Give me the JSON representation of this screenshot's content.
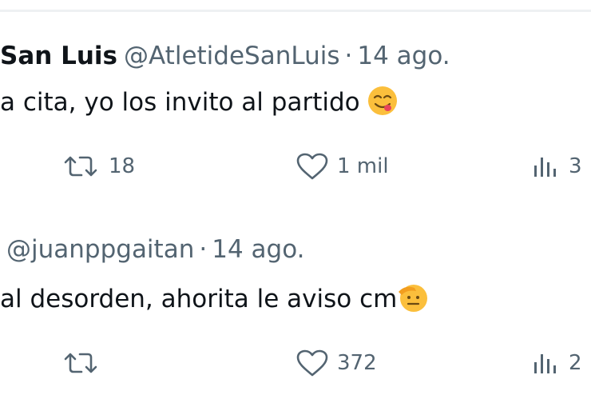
{
  "tweets": [
    {
      "display_name": "San Luis",
      "handle": "@AtletideSanLuis",
      "separator": "·",
      "time": "14 ago.",
      "text": "a cita, yo los invito al partido",
      "emoji_icon": "face-savoring-food-icon",
      "actions": {
        "retweet_count": "18",
        "like_count": "1 mil",
        "views_count": "3"
      }
    },
    {
      "handle": "@juanppgaitan",
      "separator": "·",
      "time": "14 ago.",
      "text": "al desorden, ahorita le aviso cm",
      "emoji_icon": "saluting-face-icon",
      "actions": {
        "retweet_count": "",
        "like_count": "372",
        "views_count": "2"
      }
    }
  ],
  "colors": {
    "text_primary": "#0f1419",
    "text_secondary": "#536471",
    "divider": "#eef1f3",
    "emoji_yellow": "#fbbf3c"
  }
}
